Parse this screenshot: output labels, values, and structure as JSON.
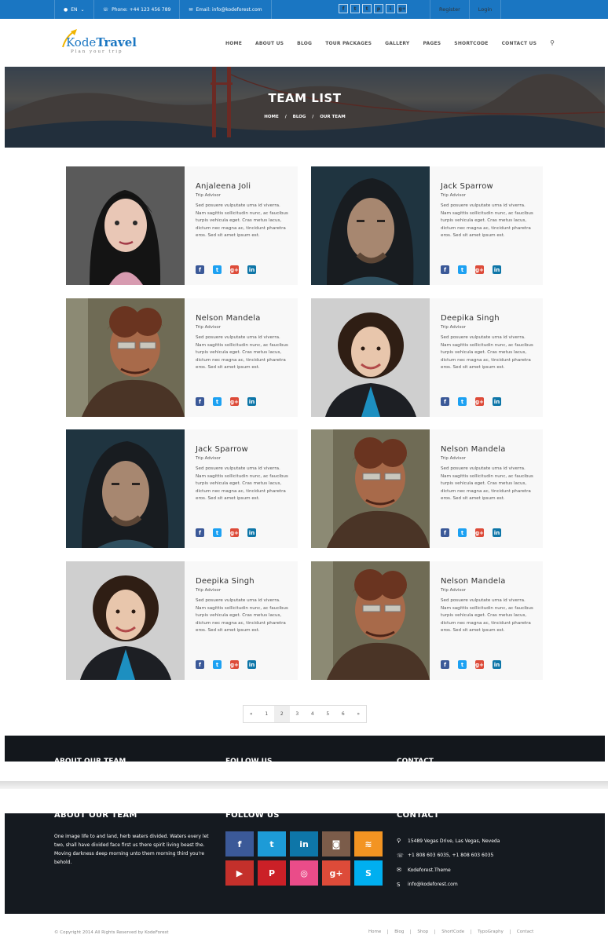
{
  "topbar": {
    "language": "EN",
    "phone": "Phone: +44 123 456 789",
    "email": "Email: info@kodeforest.com",
    "social": [
      "f",
      "t",
      "t",
      "p",
      "i",
      "g+"
    ],
    "register": "Register",
    "login": "Login"
  },
  "brand": {
    "name_a": "Kode",
    "name_b": "Travel",
    "tagline": "Plan your trip"
  },
  "nav": [
    "HOME",
    "ABOUT US",
    "BLOG",
    "TOUR PACKAGES",
    "GALLERY",
    "PAGES",
    "SHORTCODE",
    "CONTACT US"
  ],
  "banner": {
    "title": "TEAM LIST",
    "crumbs": [
      "HOME",
      "/",
      "BLOG",
      "/",
      "OUR TEAM"
    ]
  },
  "team": [
    {
      "name": "Anjaleena Joli",
      "role": "Trip Advisor",
      "desc": "Sed posuere vulputate urna id viverra. Nam sagittis sollicitudin nunc, ac faucibus turpis vehicula eget. Cras metus lacus, dictum nec magna ac, tincidunt pharetra eros. Sed sit amet ipsum est.",
      "photo": "woman-dark-hair"
    },
    {
      "name": "Jack Sparrow",
      "role": "Trip Advisor",
      "desc": "Sed posuere vulputate urna id viverra. Nam sagittis sollicitudin nunc, ac faucibus turpis vehicula eget. Cras metus lacus, dictum nec magna ac, tincidunt pharetra eros. Sed sit amet ipsum est.",
      "photo": "man-long-hair"
    },
    {
      "name": "Nelson Mandela",
      "role": "Trip Advisor",
      "desc": "Sed posuere vulputate urna id viverra. Nam sagittis sollicitudin nunc, ac faucibus turpis vehicula eget. Cras metus lacus, dictum nec magna ac, tincidunt pharetra eros. Sed sit amet ipsum est.",
      "photo": "man-sunglasses"
    },
    {
      "name": "Deepika Singh",
      "role": "Trip Advisor",
      "desc": "Sed posuere vulputate urna id viverra. Nam sagittis sollicitudin nunc, ac faucibus turpis vehicula eget. Cras metus lacus, dictum nec magna ac, tincidunt pharetra eros. Sed sit amet ipsum est.",
      "photo": "woman-curly-hair"
    },
    {
      "name": "Jack Sparrow",
      "role": "Trip Advisor",
      "desc": "Sed posuere vulputate urna id viverra. Nam sagittis sollicitudin nunc, ac faucibus turpis vehicula eget. Cras metus lacus, dictum nec magna ac, tincidunt pharetra eros. Sed sit amet ipsum est.",
      "photo": "man-long-hair"
    },
    {
      "name": "Nelson Mandela",
      "role": "Trip Advisor",
      "desc": "Sed posuere vulputate urna id viverra. Nam sagittis sollicitudin nunc, ac faucibus turpis vehicula eget. Cras metus lacus, dictum nec magna ac, tincidunt pharetra eros. Sed sit amet ipsum est.",
      "photo": "man-sunglasses"
    },
    {
      "name": "Deepika Singh",
      "role": "Trip Advisor",
      "desc": "Sed posuere vulputate urna id viverra. Nam sagittis sollicitudin nunc, ac faucibus turpis vehicula eget. Cras metus lacus, dictum nec magna ac, tincidunt pharetra eros. Sed sit amet ipsum est.",
      "photo": "woman-curly-hair"
    },
    {
      "name": "Nelson Mandela",
      "role": "Trip Advisor",
      "desc": "Sed posuere vulputate urna id viverra. Nam sagittis sollicitudin nunc, ac faucibus turpis vehicula eget. Cras metus lacus, dictum nec magna ac, tincidunt pharetra eros. Sed sit amet ipsum est.",
      "photo": "man-sunglasses"
    }
  ],
  "member_social": [
    {
      "icon": "facebook-icon",
      "glyph": "f",
      "color": "#3b5998"
    },
    {
      "icon": "twitter-icon",
      "glyph": "t",
      "color": "#1da1f2"
    },
    {
      "icon": "google-plus-icon",
      "glyph": "g+",
      "color": "#dd4b39"
    },
    {
      "icon": "linkedin-icon",
      "glyph": "in",
      "color": "#0e76a8"
    }
  ],
  "pagination": [
    "«",
    "1",
    "2",
    "3",
    "4",
    "5",
    "6",
    "»"
  ],
  "pagination_active": "2",
  "footer": {
    "about_title": "ABOUT OUR TEAM",
    "follow_title": "FOLLOW US",
    "contact_title": "CONTACT",
    "about_text": "One image life to and land, herb waters divided. Waters every let two, shall have divided face first us there spirit living beast the. Moving darkness deep morning unto them morning third you're behold.",
    "follow_tiles": [
      {
        "icon": "facebook-icon",
        "glyph": "f",
        "color": "#3b5998"
      },
      {
        "icon": "twitter-icon",
        "glyph": "t",
        "color": "#1d9bd7"
      },
      {
        "icon": "linkedin-icon",
        "glyph": "in",
        "color": "#0e76a8"
      },
      {
        "icon": "instagram-icon",
        "glyph": "◙",
        "color": "#7b5c4a"
      },
      {
        "icon": "rss-icon",
        "glyph": "≋",
        "color": "#f39422"
      },
      {
        "icon": "youtube-icon",
        "glyph": "▶",
        "color": "#c4302b"
      },
      {
        "icon": "pinterest-icon",
        "glyph": "P",
        "color": "#cb2027"
      },
      {
        "icon": "dribbble-icon",
        "glyph": "◎",
        "color": "#ea4c89"
      },
      {
        "icon": "google-plus-icon",
        "glyph": "g+",
        "color": "#dd4b39"
      },
      {
        "icon": "skype-icon",
        "glyph": "S",
        "color": "#00aff0"
      }
    ],
    "contact": [
      {
        "icon": "map-pin-icon",
        "glyph": "⚲",
        "text": "15489 Vegas Drive, Las Vegas, Neveda"
      },
      {
        "icon": "phone-icon",
        "glyph": "☏",
        "text": "+1 808 603 6035, +1 808 603 6035"
      },
      {
        "icon": "envelope-icon",
        "glyph": "✉",
        "text": "Kodeforest.Theme"
      },
      {
        "icon": "skype-icon",
        "glyph": "S",
        "text": "info@kodeforest.com"
      }
    ]
  },
  "bottom": {
    "copyright": "© Copyright 2014 All Rights Reserved by KodeForest",
    "links": [
      "Home",
      "Blog",
      "Shop",
      "ShortCode",
      "TypoGraphy",
      "Contact"
    ]
  }
}
